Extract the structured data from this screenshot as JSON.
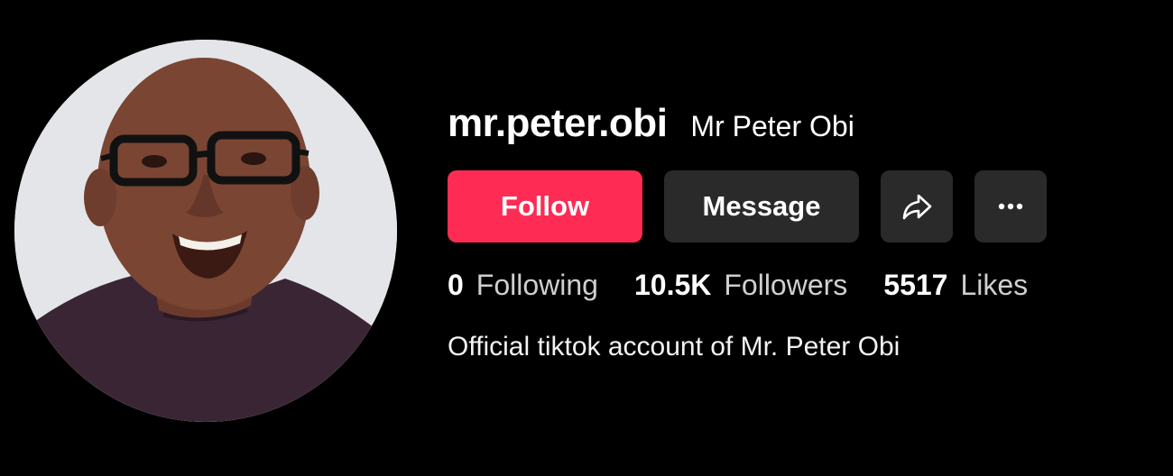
{
  "profile": {
    "username": "mr.peter.obi",
    "display_name": "Mr Peter Obi",
    "bio": "Official tiktok account of Mr. Peter Obi"
  },
  "actions": {
    "follow_label": "Follow",
    "message_label": "Message",
    "share_icon": "share-arrow-icon",
    "more_icon": "more-dots-icon"
  },
  "stats": [
    {
      "value": "0",
      "label": "Following"
    },
    {
      "value": "10.5K",
      "label": "Followers"
    },
    {
      "value": "5517",
      "label": "Likes"
    }
  ],
  "colors": {
    "background": "#000000",
    "accent": "#FE2C55",
    "button_secondary": "#2A2A2A",
    "text_primary": "#FFFFFF",
    "text_secondary": "#CFCFCF"
  }
}
